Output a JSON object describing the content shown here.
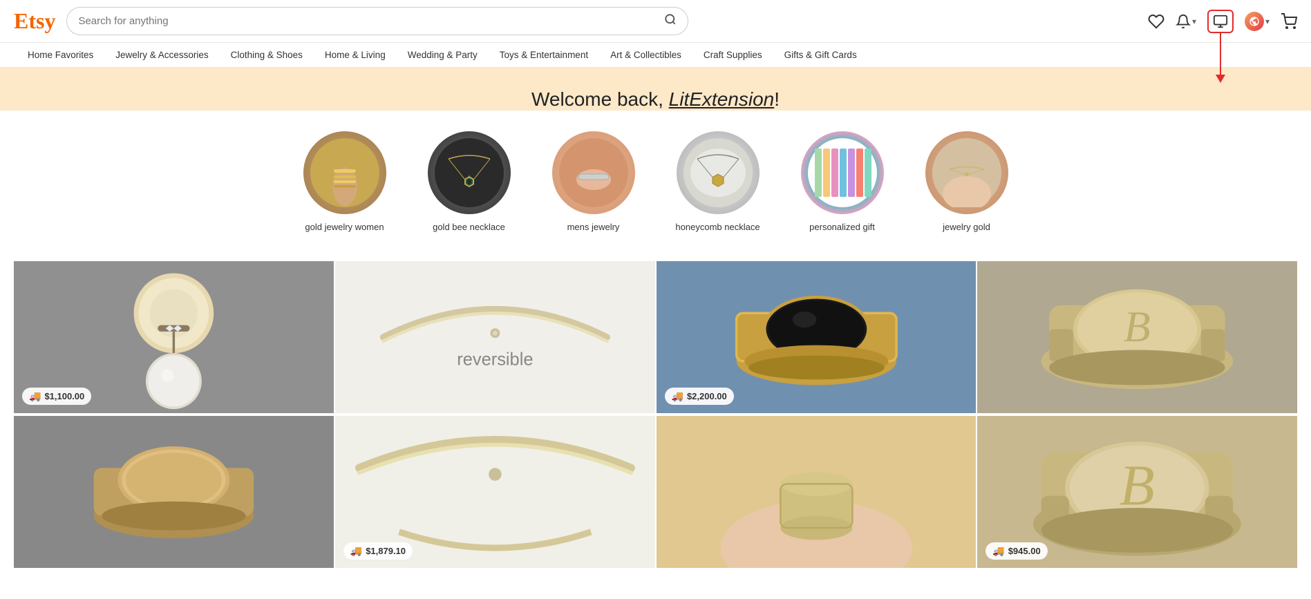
{
  "header": {
    "logo": "Etsy",
    "search_placeholder": "Search for anything",
    "icons": {
      "wishlist": "♡",
      "bell": "🔔",
      "seller": "seller-icon",
      "avatar": "avatar-icon",
      "cart": "🛒"
    }
  },
  "nav": {
    "items": [
      "Home Favorites",
      "Jewelry & Accessories",
      "Clothing & Shoes",
      "Home & Living",
      "Wedding & Party",
      "Toys & Entertainment",
      "Art & Collectibles",
      "Craft Supplies",
      "Gifts & Gift Cards"
    ]
  },
  "welcome": {
    "text_prefix": "Welcome back, ",
    "username": "LitExtension",
    "text_suffix": "!"
  },
  "categories": [
    {
      "label": "gold jewelry women",
      "circle_class": "circle-gold-jewelry"
    },
    {
      "label": "gold bee necklace",
      "circle_class": "circle-gold-bee"
    },
    {
      "label": "mens jewelry",
      "circle_class": "circle-mens-jewelry"
    },
    {
      "label": "honeycomb necklace",
      "circle_class": "circle-honeycomb"
    },
    {
      "label": "personalized gift",
      "circle_class": "circle-personalized"
    },
    {
      "label": "jewelry gold",
      "circle_class": "circle-jewelry-gold"
    }
  ],
  "products": [
    {
      "price": "$1,100.00",
      "has_delivery": true,
      "img_class": "product-img-1",
      "row": 1
    },
    {
      "price": null,
      "has_delivery": false,
      "img_class": "product-img-2",
      "row": 1
    },
    {
      "price": "$2,200.00",
      "has_delivery": true,
      "img_class": "product-img-3",
      "row": 1
    },
    {
      "price": null,
      "has_delivery": false,
      "img_class": "product-img-4",
      "row": 1
    },
    {
      "price": null,
      "has_delivery": false,
      "img_class": "product-img-5",
      "row": 2
    },
    {
      "price": "$1,879.10",
      "has_delivery": true,
      "img_class": "product-img-6",
      "row": 2
    },
    {
      "price": null,
      "has_delivery": false,
      "img_class": "product-img-7",
      "row": 2
    },
    {
      "price": "$945.00",
      "has_delivery": true,
      "img_class": "product-img-8",
      "row": 2
    }
  ],
  "annotation": {
    "box_label": "seller-dashboard-icon",
    "arrow_color": "#e22c2c"
  }
}
